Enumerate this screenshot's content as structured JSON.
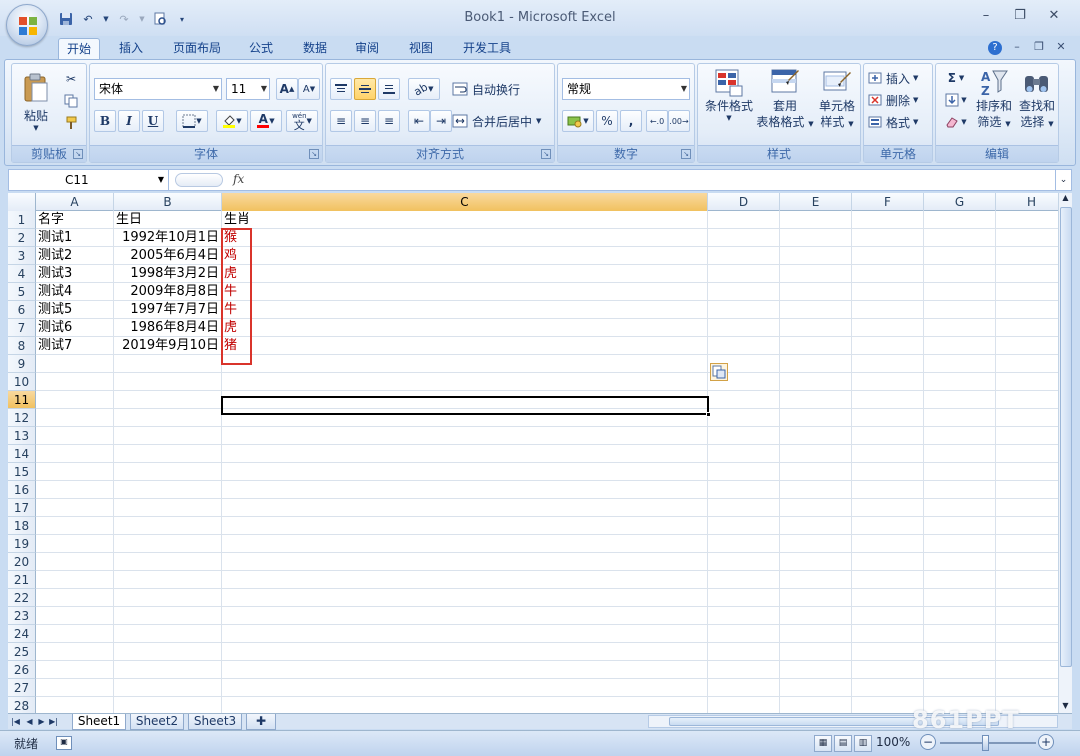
{
  "window": {
    "title": "Book1 - Microsoft Excel",
    "minimize": "–",
    "restore": "❐",
    "close": "✕"
  },
  "ribbon_tabs": [
    {
      "label": "开始",
      "active": true
    },
    {
      "label": "插入"
    },
    {
      "label": "页面布局"
    },
    {
      "label": "公式"
    },
    {
      "label": "数据"
    },
    {
      "label": "审阅"
    },
    {
      "label": "视图"
    },
    {
      "label": "开发工具"
    }
  ],
  "tab_right": {
    "help": "?",
    "minimize": "–",
    "restore": "❐",
    "close": "✕"
  },
  "groups": {
    "clipboard": {
      "label": "剪贴板",
      "paste": "粘贴"
    },
    "font": {
      "label": "字体",
      "font_name": "宋体",
      "font_size": "11",
      "bold": "B",
      "italic": "I",
      "underline": "U",
      "grow": "A",
      "shrink": "A",
      "font_color": "A",
      "phonetic": "wén",
      "phonetic_char": "文"
    },
    "alignment": {
      "label": "对齐方式",
      "wrap": "自动换行",
      "merge": "合并后居中"
    },
    "number": {
      "label": "数字",
      "format": "常规",
      "percent": "%",
      "comma": ","
    },
    "styles": {
      "label": "样式",
      "cond_format": "条件格式",
      "table_format_1": "套用",
      "table_format_2": "表格格式",
      "cell_style_1": "单元格",
      "cell_style_2": "样式"
    },
    "cells": {
      "label": "单元格",
      "insert": "插入",
      "delete": "删除",
      "format": "格式"
    },
    "editing": {
      "label": "编辑",
      "sigma": "Σ",
      "sort_1": "排序和",
      "sort_2": "筛选",
      "find_1": "查找和",
      "find_2": "选择"
    }
  },
  "formula_bar": {
    "name_box": "C11",
    "fx": "fx",
    "value": ""
  },
  "columns": [
    "A",
    "B",
    "C",
    "D",
    "E",
    "F",
    "G",
    "H"
  ],
  "selected_column": "C",
  "selected_row": 11,
  "rows": [
    {
      "n": "1",
      "a": "名字",
      "b": "生日",
      "c": "生肖"
    },
    {
      "n": "2",
      "a": "测试1",
      "b": "1992年10月1日",
      "c": "猴"
    },
    {
      "n": "3",
      "a": "测试2",
      "b": "2005年6月4日",
      "c": "鸡"
    },
    {
      "n": "4",
      "a": "测试3",
      "b": "1998年3月2日",
      "c": "虎"
    },
    {
      "n": "5",
      "a": "测试4",
      "b": "2009年8月8日",
      "c": "牛"
    },
    {
      "n": "6",
      "a": "测试5",
      "b": "1997年7月7日",
      "c": "牛"
    },
    {
      "n": "7",
      "a": "测试6",
      "b": "1986年8月4日",
      "c": "虎"
    },
    {
      "n": "8",
      "a": "测试7",
      "b": "2019年9月10日",
      "c": "猪"
    },
    {
      "n": "9"
    },
    {
      "n": "10"
    },
    {
      "n": "11"
    },
    {
      "n": "12"
    },
    {
      "n": "13"
    },
    {
      "n": "14"
    },
    {
      "n": "15"
    },
    {
      "n": "16"
    },
    {
      "n": "17"
    },
    {
      "n": "18"
    },
    {
      "n": "19"
    },
    {
      "n": "20"
    },
    {
      "n": "21"
    },
    {
      "n": "22"
    },
    {
      "n": "23"
    },
    {
      "n": "24"
    },
    {
      "n": "25"
    },
    {
      "n": "26"
    },
    {
      "n": "27"
    },
    {
      "n": "28"
    }
  ],
  "sheets": [
    {
      "label": "Sheet1",
      "active": true
    },
    {
      "label": "Sheet2"
    },
    {
      "label": "Sheet3"
    }
  ],
  "status": {
    "ready": "就绪",
    "zoom": "100%"
  },
  "watermark": "861PPT",
  "colors": {
    "accent": "#15428b",
    "highlight_text": "#c00000",
    "annotation_box": "#d9342b"
  }
}
